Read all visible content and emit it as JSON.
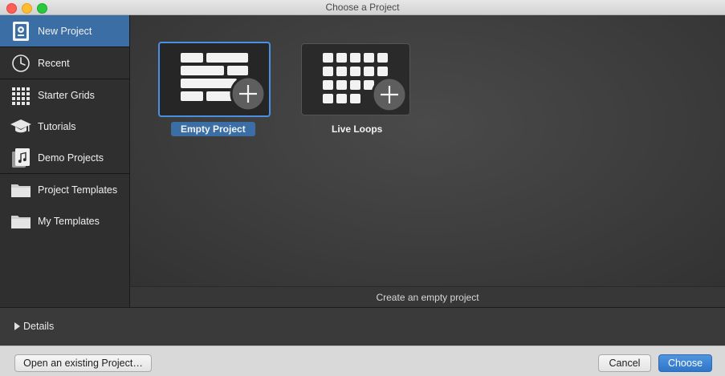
{
  "window": {
    "title": "Choose a Project"
  },
  "sidebar": {
    "items": [
      {
        "label": "New Project",
        "icon": "new-project-icon",
        "selected": true
      },
      {
        "label": "Recent",
        "icon": "clock-icon",
        "selected": false
      },
      {
        "label": "Starter Grids",
        "icon": "grid-icon",
        "selected": false
      },
      {
        "label": "Tutorials",
        "icon": "mortarboard-icon",
        "selected": false
      },
      {
        "label": "Demo Projects",
        "icon": "music-document-icon",
        "selected": false
      },
      {
        "label": "Project Templates",
        "icon": "folder-icon",
        "selected": false
      },
      {
        "label": "My Templates",
        "icon": "folder-icon",
        "selected": false
      }
    ]
  },
  "templates": [
    {
      "label": "Empty Project",
      "icon": "empty-project-icon",
      "selected": true
    },
    {
      "label": "Live Loops",
      "icon": "live-loops-icon",
      "selected": false
    }
  ],
  "status": {
    "text": "Create an empty project"
  },
  "details": {
    "label": "Details",
    "expanded": false
  },
  "footer": {
    "open_label": "Open an existing Project…",
    "cancel_label": "Cancel",
    "choose_label": "Choose"
  },
  "colors": {
    "accent": "#3a6ea5",
    "selection_border": "#4a90e2",
    "primary_button": "#2f76c9"
  }
}
